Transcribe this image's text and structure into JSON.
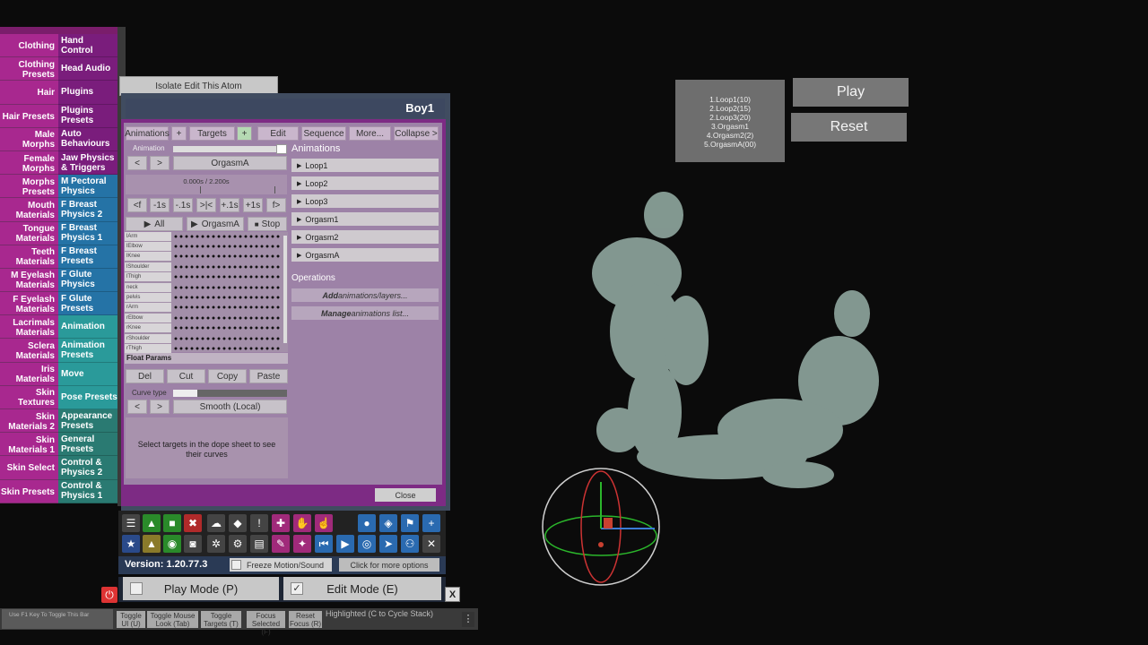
{
  "left_tabs": [
    {
      "left": "Clothing",
      "right": "Hand Control",
      "rc": "#7a1d7c"
    },
    {
      "left": "Clothing Presets",
      "right": "Head Audio",
      "rc": "#7a1d7c"
    },
    {
      "left": "Hair",
      "right": "Plugins",
      "rc": "#7a1d7c"
    },
    {
      "left": "Hair Presets",
      "right": "Plugins Presets",
      "rc": "#7a1d7c"
    },
    {
      "left": "Male Morphs",
      "right": "Auto Behaviours",
      "rc": "#7a1d7c"
    },
    {
      "left": "Female Morphs",
      "right": "Jaw Physics & Triggers",
      "rc": "#7a1d7c"
    },
    {
      "left": "Morphs Presets",
      "right": "M Pectoral Physics",
      "rc": "#2573a6"
    },
    {
      "left": "Mouth Materials",
      "right": "F Breast Physics 2",
      "rc": "#2573a6"
    },
    {
      "left": "Tongue Materials",
      "right": "F Breast Physics 1",
      "rc": "#2573a6"
    },
    {
      "left": "Teeth Materials",
      "right": "F Breast Presets",
      "rc": "#2573a6"
    },
    {
      "left": "M Eyelash Materials",
      "right": "F Glute Physics",
      "rc": "#2573a6"
    },
    {
      "left": "F Eyelash Materials",
      "right": "F Glute Presets",
      "rc": "#2573a6"
    },
    {
      "left": "Lacrimals Materials",
      "right": "Animation",
      "rc": "#2a9a9a"
    },
    {
      "left": "Sclera Materials",
      "right": "Animation Presets",
      "rc": "#2a9a9a"
    },
    {
      "left": "Iris Materials",
      "right": "Move",
      "rc": "#2a9a9a"
    },
    {
      "left": "Skin Textures",
      "right": "Pose Presets",
      "rc": "#2a9a9a"
    },
    {
      "left": "Skin Materials 2",
      "right": "Appearance Presets",
      "rc": "#2a7a72"
    },
    {
      "left": "Skin Materials 1",
      "right": "General Presets",
      "rc": "#2a7a72"
    },
    {
      "left": "Skin Select",
      "right": "Control & Physics 2",
      "rc": "#2a7a72"
    },
    {
      "left": "Skin Presets",
      "right": "Control & Physics 1",
      "rc": "#2a7a72"
    }
  ],
  "isolate_button": "Isolate Edit This Atom",
  "panel_title": "Boy1",
  "toolbar": {
    "animations": "Animations",
    "plus1": "+",
    "targets": "Targets",
    "plus2": "+",
    "edit": "Edit",
    "sequence": "Sequence",
    "more": "More...",
    "collapse": "Collapse >"
  },
  "animation_label": "Animation",
  "prev": "<",
  "next": ">",
  "current_animation": "OrgasmA",
  "time_display": "0.000s / 2.200s",
  "step_buttons": [
    "<f",
    "-1s",
    "-.1s",
    ">|<",
    "+.1s",
    "+1s",
    "f>"
  ],
  "play_all": "All",
  "play_current": "OrgasmA",
  "stop": "Stop",
  "dope_rows": [
    "lArm",
    "lElbow",
    "lKnee",
    "lShoulder",
    "lThigh",
    "neck",
    "pelvis",
    "rArm",
    "rElbow",
    "rKnee",
    "rShoulder",
    "rThigh"
  ],
  "float_params": "Float Params",
  "edit_buttons": [
    "Del",
    "Cut",
    "Copy",
    "Paste"
  ],
  "curve_type_label": "Curve type",
  "curve_type_value": "Smooth (Local)",
  "hint_text": "Select targets in the dope sheet to see their curves",
  "animations_header": "Animations",
  "animations_list": [
    "Loop1",
    "Loop2",
    "Loop3",
    "Orgasm1",
    "Orgasm2",
    "OrgasmA"
  ],
  "operations_header": "Operations",
  "op_add_em": "Add",
  "op_add_rest": " animations/layers...",
  "op_manage_em": "Manage",
  "op_manage_rest": " animations list...",
  "close_button": "Close",
  "version": "Version: 1.20.77.3",
  "freeze_label": "Freeze Motion/Sound",
  "more_options": "Click for more options",
  "play_mode": "Play Mode (P)",
  "edit_mode": "Edit Mode (E)",
  "close_x": "X",
  "f1_hint": "Use F1 Key To Toggle This Bar",
  "bottom_buttons": [
    "Toggle UI (U)",
    "Toggle Mouse Look (Tab)",
    "Toggle Targets (T)",
    "Focus Selected (F)",
    "Reset Focus (R)"
  ],
  "highlight_text": "Highlighted (C to Cycle Stack)",
  "playlist": [
    "1.Loop1(10)",
    "2.Loop2(15)",
    "2.Loop3(20)",
    "3.Orgasm1",
    "4.Orgasm2(2)",
    "5.OrgasmA(00)"
  ],
  "play_button": "Play",
  "reset_button": "Reset"
}
